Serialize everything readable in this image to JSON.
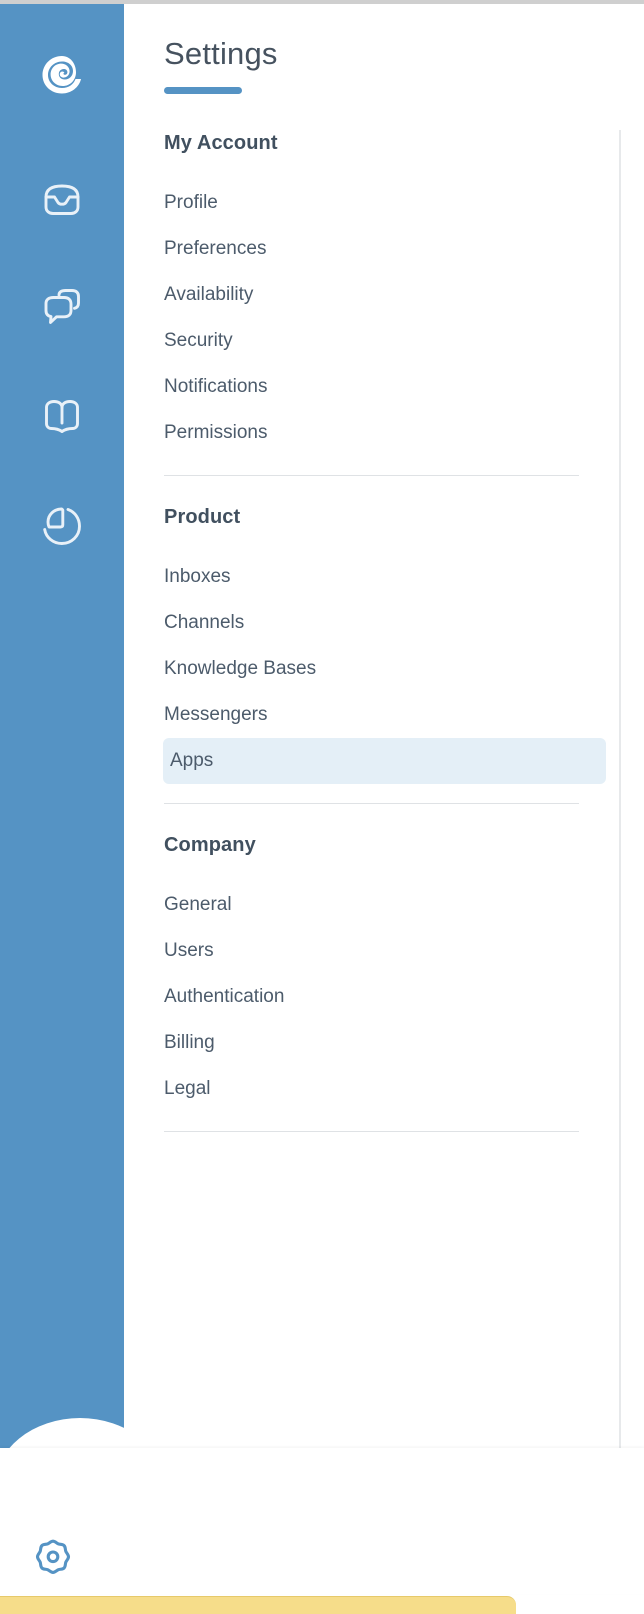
{
  "app": {
    "accent_blue": "#5593c4",
    "sidebar_bg": "#5593c4",
    "text_color": "#4c5b6b",
    "heading_color": "#41505f",
    "active_item_bg": "#e4eff7",
    "toast_color": "#f6dd8a"
  },
  "rail": {
    "items": [
      {
        "name": "logo",
        "icon": "spiral-logo-icon",
        "label": "Logo"
      },
      {
        "name": "inbox",
        "icon": "inbox-icon",
        "label": "Inbox"
      },
      {
        "name": "chat",
        "icon": "chat-bubbles-icon",
        "label": "Conversations"
      },
      {
        "name": "knowledge",
        "icon": "open-book-icon",
        "label": "Knowledge"
      },
      {
        "name": "reports",
        "icon": "pie-chart-icon",
        "label": "Reports"
      }
    ],
    "settings_button": {
      "icon": "gear-icon",
      "label": "Settings"
    }
  },
  "header": {
    "title": "Settings"
  },
  "sections": [
    {
      "heading": "My Account",
      "items": [
        {
          "label": "Profile",
          "active": false
        },
        {
          "label": "Preferences",
          "active": false
        },
        {
          "label": "Availability",
          "active": false
        },
        {
          "label": "Security",
          "active": false
        },
        {
          "label": "Notifications",
          "active": false
        },
        {
          "label": "Permissions",
          "active": false
        }
      ]
    },
    {
      "heading": "Product",
      "items": [
        {
          "label": "Inboxes",
          "active": false
        },
        {
          "label": "Channels",
          "active": false
        },
        {
          "label": "Knowledge Bases",
          "active": false
        },
        {
          "label": "Messengers",
          "active": false
        },
        {
          "label": "Apps",
          "active": true
        }
      ]
    },
    {
      "heading": "Company",
      "items": [
        {
          "label": "General",
          "active": false
        },
        {
          "label": "Users",
          "active": false
        },
        {
          "label": "Authentication",
          "active": false
        },
        {
          "label": "Billing",
          "active": false
        },
        {
          "label": "Legal",
          "active": false
        }
      ]
    }
  ]
}
